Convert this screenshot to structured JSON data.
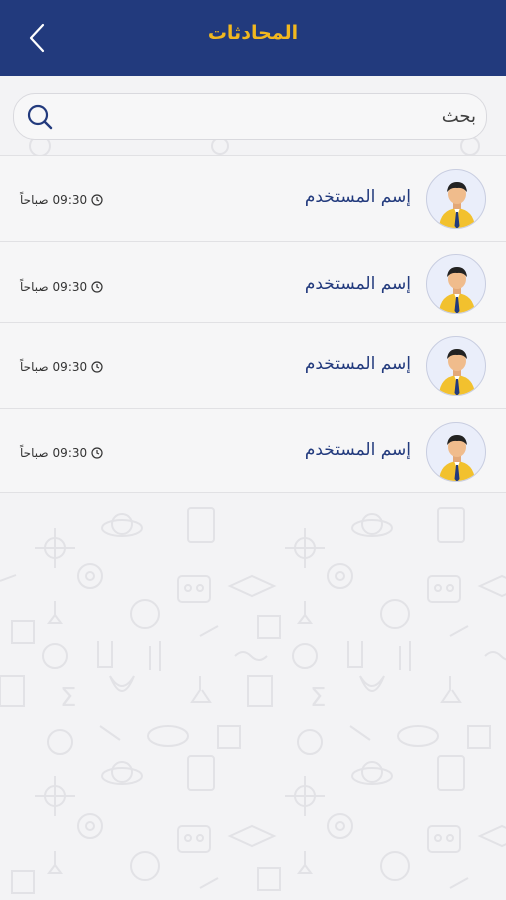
{
  "header": {
    "title": "المحادثات",
    "back_icon": "chevron-left-icon",
    "background_color": "#223a7d",
    "title_color": "#f2b81f"
  },
  "search": {
    "placeholder": "بحث",
    "icon": "search-icon"
  },
  "conversations": [
    {
      "name": "إسم المستخدم",
      "time": "09:30",
      "period": "صباحاً"
    },
    {
      "name": "إسم المستخدم",
      "time": "09:30",
      "period": "صباحاً"
    },
    {
      "name": "إسم المستخدم",
      "time": "09:30",
      "period": "صباحاً"
    },
    {
      "name": "إسم المستخدم",
      "time": "09:30",
      "period": "صباحاً"
    }
  ]
}
